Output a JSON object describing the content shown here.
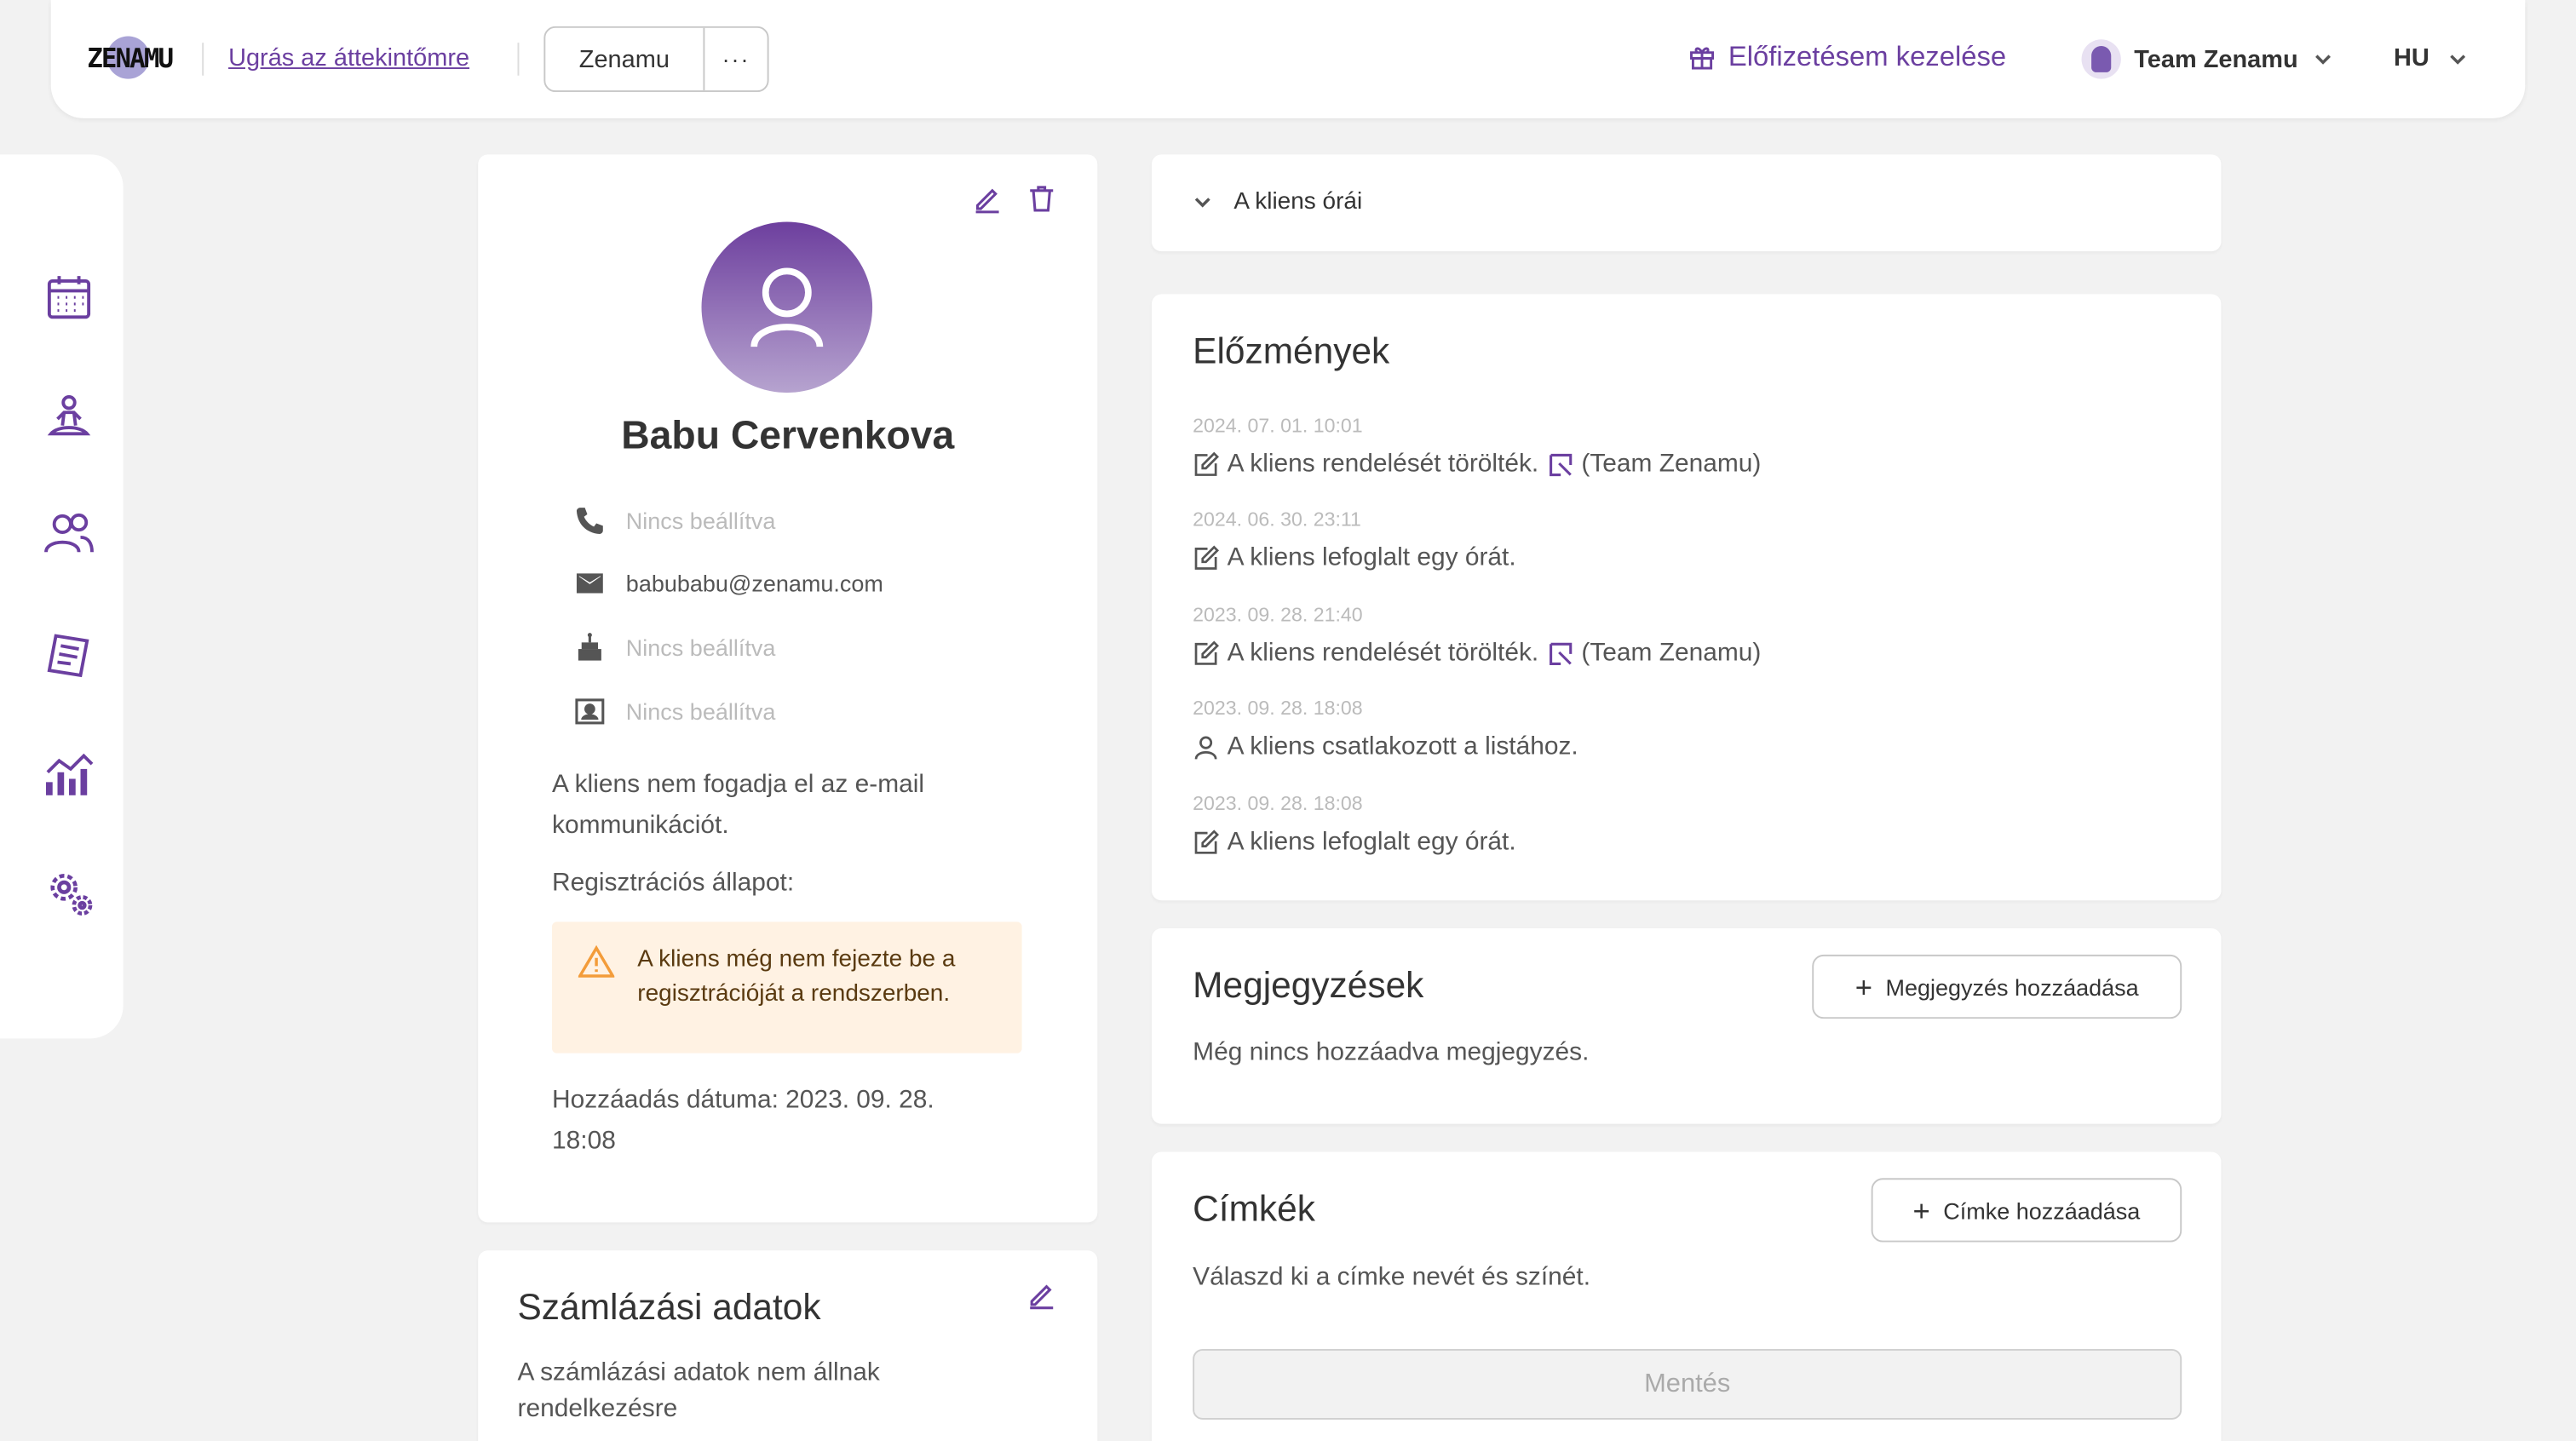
{
  "app": {
    "logo_text": "ZENAMU",
    "back_link": "Ugrás az áttekintőmre",
    "workspace": "Zenamu",
    "workspace_more": "···",
    "subscription_link": "Előfizetésem kezelése",
    "team_name": "Team Zenamu",
    "language": "HU",
    "accent_color": "#6b3fa0"
  },
  "sidebar": {
    "items": [
      {
        "icon": "calendar-icon"
      },
      {
        "icon": "meditation-icon"
      },
      {
        "icon": "clients-icon"
      },
      {
        "icon": "orders-icon"
      },
      {
        "icon": "statistics-icon"
      },
      {
        "icon": "settings-icon"
      }
    ]
  },
  "client": {
    "name": "Babu Cervenkova",
    "phone": "Nincs beállítva",
    "email": "babubabu@zenamu.com",
    "birthday": "Nincs beállítva",
    "contact": "Nincs beállítva",
    "email_consent": "A kliens nem fogadja el az e-mail kommunikációt.",
    "registration_label": "Regisztrációs állapot:",
    "registration_warning": "A kliens még nem fejezte be a regisztrációját a rendszerben.",
    "added_date": "Hozzáadás dátuma: 2023. 09. 28. 18:08"
  },
  "billing": {
    "title": "Számlázási adatok",
    "text": "A számlázási adatok nem állnak rendelkezésre"
  },
  "lessons": {
    "title": "A kliens órái"
  },
  "history": {
    "title": "Előzmények",
    "items": [
      {
        "ts": "2024. 07. 01. 10:01",
        "text": "A kliens rendelését törölték.",
        "by": "(Team Zenamu)",
        "icon": "edit-icon"
      },
      {
        "ts": "2024. 06. 30. 23:11",
        "text": "A kliens lefoglalt egy órát.",
        "by": "",
        "icon": "edit-icon"
      },
      {
        "ts": "2023. 09. 28. 21:40",
        "text": "A kliens rendelését törölték.",
        "by": "(Team Zenamu)",
        "icon": "edit-icon"
      },
      {
        "ts": "2023. 09. 28. 18:08",
        "text": "A kliens csatlakozott a listához.",
        "by": "",
        "icon": "user-icon"
      },
      {
        "ts": "2023. 09. 28. 18:08",
        "text": "A kliens lefoglalt egy órát.",
        "by": "",
        "icon": "edit-icon"
      }
    ]
  },
  "notes": {
    "title": "Megjegyzések",
    "add_button": "Megjegyzés hozzáadása",
    "empty": "Még nincs hozzáadva megjegyzés."
  },
  "tags": {
    "title": "Címkék",
    "add_button": "Címke hozzáadása",
    "hint": "Válaszd ki a címke nevét és színét.",
    "save_button": "Mentés"
  }
}
